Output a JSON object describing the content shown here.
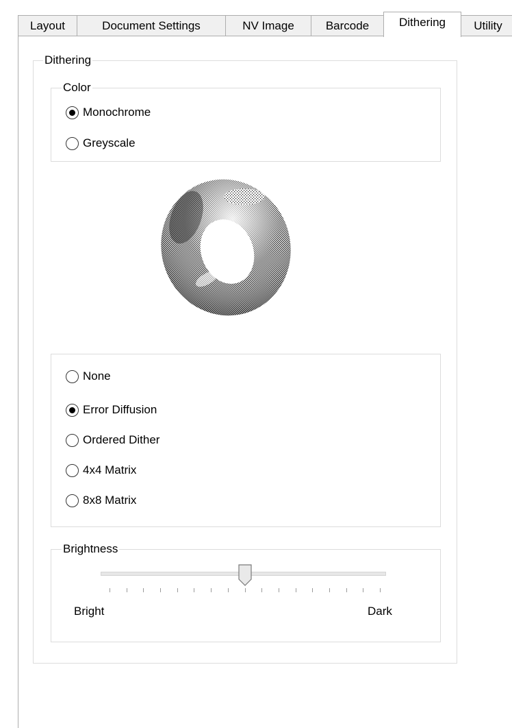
{
  "tabs": [
    {
      "label": "Layout",
      "active": false
    },
    {
      "label": "Document Settings",
      "active": false
    },
    {
      "label": "NV Image",
      "active": false
    },
    {
      "label": "Barcode",
      "active": false
    },
    {
      "label": "Dithering",
      "active": true
    },
    {
      "label": "Utility",
      "active": false
    }
  ],
  "dithering_group": {
    "title": "Dithering"
  },
  "color_group": {
    "title": "Color",
    "options": [
      {
        "label": "Monochrome",
        "checked": true
      },
      {
        "label": "Greyscale",
        "checked": false
      }
    ]
  },
  "preview": {
    "icon": "torus-dither-preview"
  },
  "method_group": {
    "options": [
      {
        "label": "None",
        "checked": false
      },
      {
        "label": "Error Diffusion",
        "checked": true
      },
      {
        "label": "Ordered Dither",
        "checked": false
      },
      {
        "label": "4x4 Matrix",
        "checked": false
      },
      {
        "label": "8x8 Matrix",
        "checked": false
      }
    ]
  },
  "brightness": {
    "title": "Brightness",
    "min_label": "Bright",
    "max_label": "Dark",
    "value_fraction": 0.5,
    "tick_count": 17
  }
}
